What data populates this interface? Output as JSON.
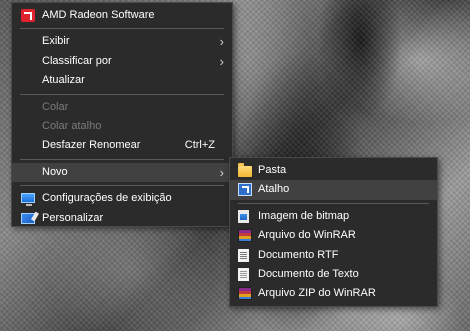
{
  "context_menu": {
    "items": [
      {
        "label": "AMD Radeon Software",
        "icon": "amd-icon"
      },
      {
        "label": "Exibir"
      },
      {
        "label": "Classificar por"
      },
      {
        "label": "Atualizar"
      },
      {
        "label": "Colar"
      },
      {
        "label": "Colar atalho"
      },
      {
        "label": "Desfazer Renomear",
        "shortcut": "Ctrl+Z"
      },
      {
        "label": "Novo"
      },
      {
        "label": "Configurações de exibição",
        "icon": "display-settings-icon"
      },
      {
        "label": "Personalizar",
        "icon": "personalize-icon"
      }
    ],
    "arrow_glyph": "›"
  },
  "submenu": {
    "items": [
      {
        "label": "Pasta",
        "icon": "folder-icon"
      },
      {
        "label": "Atalho",
        "icon": "shortcut-icon"
      },
      {
        "label": "Imagem de bitmap",
        "icon": "bitmap-icon"
      },
      {
        "label": "Arquivo do WinRAR",
        "icon": "winrar-icon"
      },
      {
        "label": "Documento RTF",
        "icon": "rtf-document-icon"
      },
      {
        "label": "Documento de Texto",
        "icon": "text-document-icon"
      },
      {
        "label": "Arquivo ZIP do WinRAR",
        "icon": "winrar-zip-icon"
      }
    ]
  },
  "colors": {
    "menu_background": "#2b2b2b",
    "highlight": "#414141",
    "disabled_text": "#7a7a7a",
    "amd_red": "#e0242e"
  }
}
